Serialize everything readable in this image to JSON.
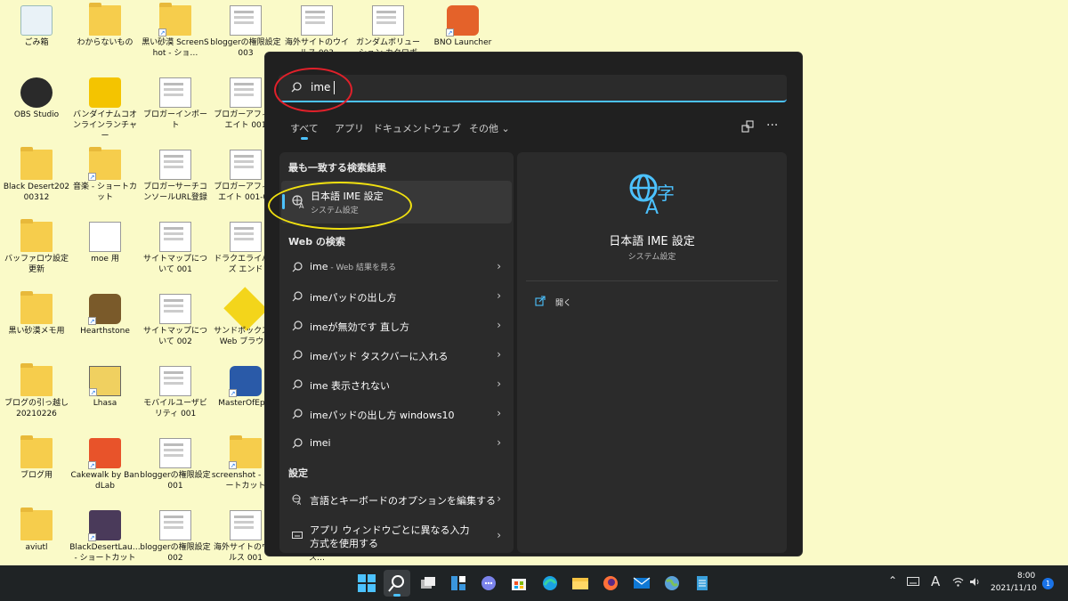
{
  "desktop": {
    "icons": [
      {
        "label": "ごみ箱",
        "icon": "recycle-bin-icon"
      },
      {
        "label": "わからないもの",
        "icon": "folder-icon"
      },
      {
        "label": "黒い砂漠 ScreenShot - ショ…",
        "icon": "folder-shortcut-icon"
      },
      {
        "label": "bloggerの権限設定003",
        "icon": "screenshot-file-icon"
      },
      {
        "label": "海外サイトのウイルス 003",
        "icon": "screenshot-file-icon"
      },
      {
        "label": "ガンダムボリューション カクロボプ…カテス…",
        "icon": "screenshot-file-icon"
      },
      {
        "label": "BNO Launcher",
        "icon": "bno-launcher-icon"
      },
      {
        "label": "OBS Studio",
        "icon": "obs-studio-icon"
      },
      {
        "label": "バンダイナムコオンラインランチャー",
        "icon": "bandai-namco-launcher-icon"
      },
      {
        "label": "ブロガーインポート",
        "icon": "screenshot-file-icon"
      },
      {
        "label": "ブロガーアフィリエイト 001",
        "icon": "screenshot-file-icon"
      },
      {
        "label": "Black Desert20200312",
        "icon": "folder-icon"
      },
      {
        "label": "音楽 - ショートカット",
        "icon": "folder-shortcut-icon"
      },
      {
        "label": "ブロガーサーチコンソールURL登録",
        "icon": "screenshot-file-icon"
      },
      {
        "label": "ブロガーアフィリエイト 001-01",
        "icon": "screenshot-file-icon"
      },
      {
        "label": "バッファロウ設定更新",
        "icon": "folder-icon"
      },
      {
        "label": "moe 用",
        "icon": "text-file-icon"
      },
      {
        "label": "サイトマップについて 001",
        "icon": "screenshot-file-icon"
      },
      {
        "label": "ドラクエライバルズ エンド",
        "icon": "screenshot-file-icon"
      },
      {
        "label": "黒い砂漠メモ用",
        "icon": "folder-icon"
      },
      {
        "label": "Hearthstone",
        "icon": "hearthstone-icon"
      },
      {
        "label": "サイトマップについて 002",
        "icon": "screenshot-file-icon"
      },
      {
        "label": "サンドボックス化 Web ブラウザ",
        "icon": "sandboxie-icon"
      },
      {
        "label": "ブログの引っ越し 20210226",
        "icon": "folder-icon"
      },
      {
        "label": "Lhasa",
        "icon": "lhasa-icon"
      },
      {
        "label": "モバイルユーザビリティ 001",
        "icon": "screenshot-file-icon"
      },
      {
        "label": "MasterOfEp…",
        "icon": "master-of-epic-icon"
      },
      {
        "label": "ブログ用",
        "icon": "folder-icon"
      },
      {
        "label": "Cakewalk by BandLab",
        "icon": "cakewalk-icon"
      },
      {
        "label": "bloggerの権限設定001",
        "icon": "screenshot-file-icon"
      },
      {
        "label": "screenshot - ショートカット",
        "icon": "folder-shortcut-icon"
      },
      {
        "label": "aviutl",
        "icon": "folder-icon"
      },
      {
        "label": "BlackDesertLau… - ショートカット",
        "icon": "black-desert-launcher-icon"
      },
      {
        "label": "bloggerの権限設定002",
        "icon": "screenshot-file-icon"
      },
      {
        "label": "海外サイトのウイルス 001",
        "icon": "screenshot-file-icon"
      },
      {
        "label": "クロウズベータテス…",
        "icon": "screenshot-file-icon"
      }
    ]
  },
  "search": {
    "query": "ime",
    "tabs": [
      "すべて",
      "アプリ",
      "ドキュメント",
      "ウェブ",
      "その他 ⌄"
    ],
    "best_match_header": "最も一致する検索結果",
    "best_match": {
      "title": "日本語 IME 設定",
      "subtitle": "システム設定"
    },
    "web_header": "Web の検索",
    "web_results": [
      {
        "text": "ime",
        "sub": " - Web 結果を見る"
      },
      {
        "text": "imeパッドの出し方",
        "sub": ""
      },
      {
        "text": "imeが無効です 直し方",
        "sub": ""
      },
      {
        "text": "imeパッド タスクバーに入れる",
        "sub": ""
      },
      {
        "text": "ime 表示されない",
        "sub": ""
      },
      {
        "text": "imeパッドの出し方 windows10",
        "sub": ""
      },
      {
        "text": "imei",
        "sub": ""
      }
    ],
    "settings_header": "設定",
    "settings_results": [
      {
        "text": "言語とキーボードのオプションを編集する",
        "icon": "language-settings-icon"
      },
      {
        "text": "アプリ ウィンドウごとに異なる入力方式を使用する",
        "icon": "keyboard-icon"
      }
    ],
    "detail": {
      "title": "日本語 IME 設定",
      "subtitle": "システム設定",
      "open_label": "開く"
    }
  },
  "taskbar": {
    "icons": [
      "windows-start-icon",
      "search-icon",
      "task-view-icon",
      "widgets-icon",
      "chat-icon",
      "microsoft-store-icon",
      "edge-icon",
      "file-explorer-icon",
      "firefox-icon",
      "mail-icon",
      "globe-app-icon",
      "notepad-icon"
    ],
    "ime_mode": "A",
    "time": "8:00",
    "date": "2021/11/10",
    "notifications": "1"
  },
  "colors": {
    "accent": "#4cc2ff",
    "panel": "#202020",
    "card": "#2b2b2b",
    "desktop": "#fafac8",
    "taskbar": "#1f2325",
    "annotation_red": "#e0202a",
    "annotation_yellow": "#f0e010"
  }
}
